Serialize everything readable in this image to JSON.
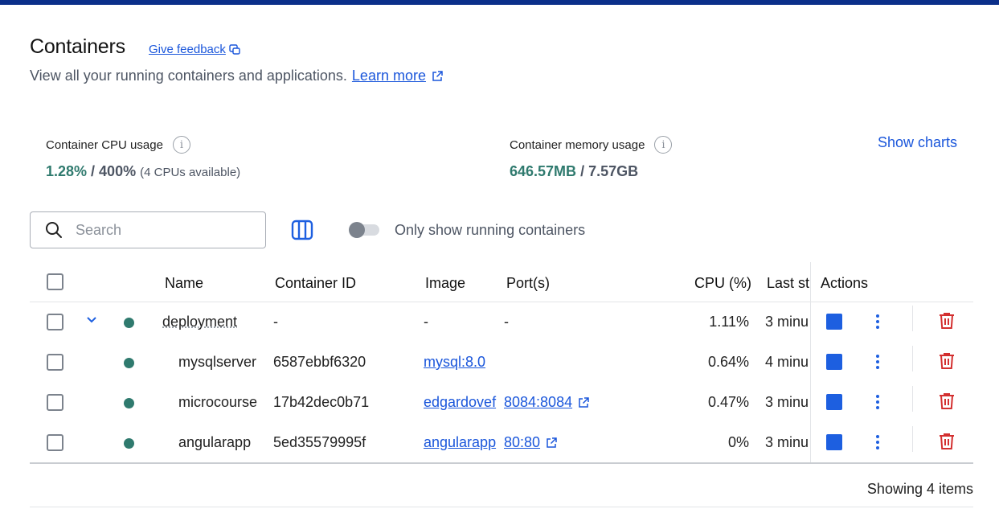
{
  "header": {
    "title": "Containers",
    "feedback_label": "Give feedback",
    "subtitle": "View all your running containers and applications.",
    "learn_more": "Learn more"
  },
  "stats": {
    "cpu_label": "Container CPU usage",
    "cpu_used": "1.28%",
    "cpu_total": " / 400%",
    "cpu_note": "(4 CPUs available)",
    "mem_label": "Container memory usage",
    "mem_used": "646.57MB",
    "mem_total": " / 7.57GB",
    "show_charts": "Show charts"
  },
  "toolbar": {
    "search_placeholder": "Search",
    "running_only_label": "Only show running containers",
    "running_only_enabled": false
  },
  "table": {
    "columns": {
      "name": "Name",
      "container_id": "Container ID",
      "image": "Image",
      "ports": "Port(s)",
      "cpu": "CPU (%)",
      "last_started": "Last st",
      "actions": "Actions"
    },
    "rows": [
      {
        "name": "deployment",
        "container_id": "-",
        "image": "-",
        "ports": "-",
        "cpu": "1.11%",
        "last_started": "3 minu"
      },
      {
        "name": "mysqlserver",
        "container_id": "6587ebbf6320",
        "image": "mysql:8.0",
        "ports": "",
        "cpu": "0.64%",
        "last_started": "4 minu"
      },
      {
        "name": "microcourse",
        "container_id": "17b42dec0b71",
        "image": "edgardovef",
        "ports": "8084:8084",
        "cpu": "0.47%",
        "last_started": "3 minu"
      },
      {
        "name": "angularapp",
        "container_id": "5ed35579995f",
        "image": "angularapp",
        "ports": "80:80",
        "cpu": "0%",
        "last_started": "3 minu"
      }
    ]
  },
  "footer": {
    "showing": "Showing 4 items"
  },
  "colors": {
    "accent": "#1a56db",
    "running": "#2f7a6e",
    "stop": "#1d5fe0",
    "delete": "#d32f2f",
    "topbar": "#0b2f8a"
  }
}
